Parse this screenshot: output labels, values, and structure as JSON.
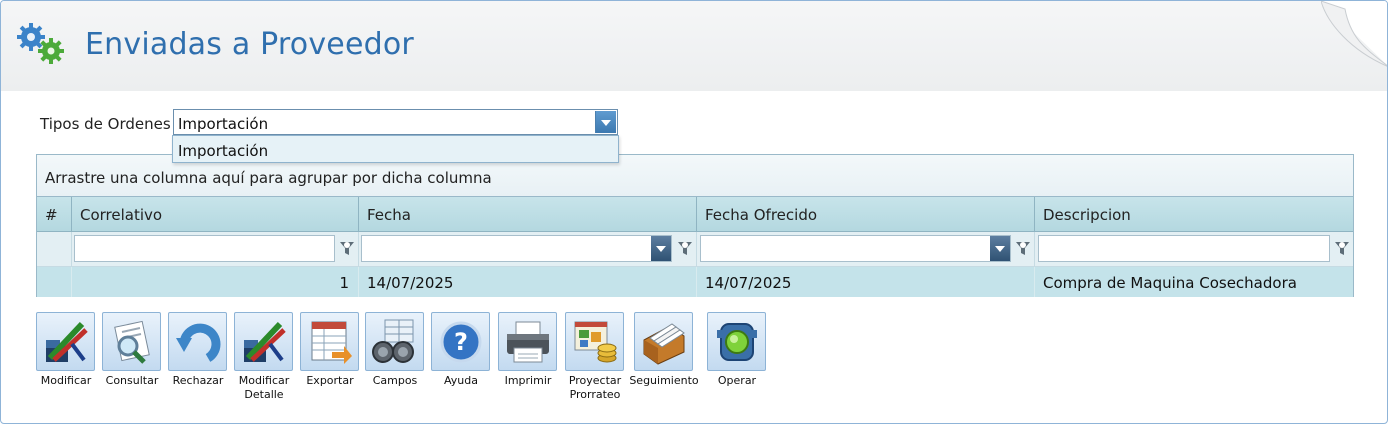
{
  "page": {
    "title": "Enviadas a Proveedor"
  },
  "filter": {
    "label": "Tipos de Ordenes",
    "selected": "Importación",
    "options": [
      "Importación"
    ]
  },
  "grid": {
    "group_hint": "Arrastre una columna aquí para agrupar por dicha columna",
    "columns": [
      "#",
      "Correlativo",
      "Fecha",
      "Fecha Ofrecido",
      "Descripcion"
    ],
    "rows": [
      {
        "correlativo": "1",
        "fecha": "14/07/2025",
        "fecha_ofrecido": "14/07/2025",
        "descripcion": "Compra de Maquina Cosechadora"
      }
    ]
  },
  "toolbar": {
    "modificar": "Modificar",
    "consultar": "Consultar",
    "rechazar": "Rechazar",
    "modificar_detalle_1": "Modificar",
    "modificar_detalle_2": "Detalle",
    "exportar": "Exportar",
    "campos": "Campos",
    "ayuda": "Ayuda",
    "imprimir": "Imprimir",
    "proyectar_1": "Proyectar",
    "proyectar_2": "Prorrateo",
    "seguimiento": "Seguimiento",
    "operar": "Operar"
  },
  "colors": {
    "title": "#2f6fae",
    "grid_header": "#b4d8e0",
    "row": "#c4e3ea"
  }
}
